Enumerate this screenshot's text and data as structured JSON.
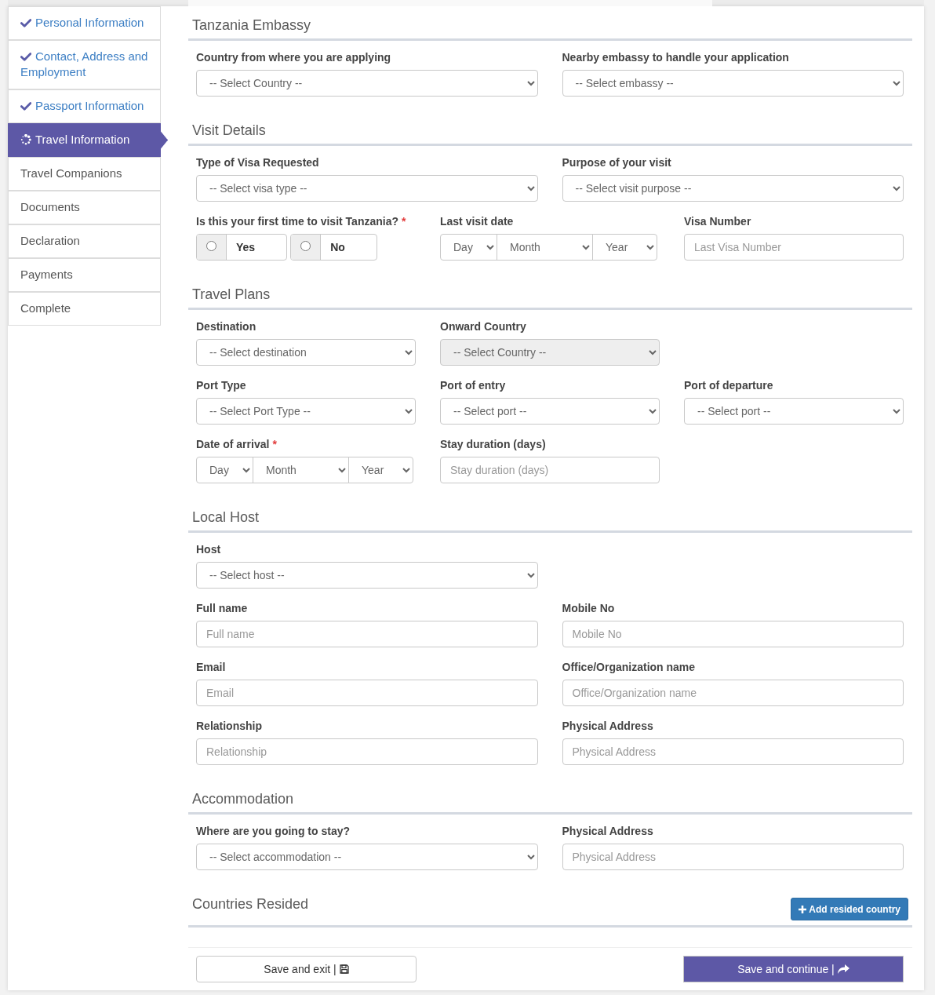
{
  "sidebar": {
    "items": [
      {
        "label": "Personal Information",
        "completed": true,
        "selected": false
      },
      {
        "label": "Contact, Address and Employment",
        "completed": true,
        "selected": false
      },
      {
        "label": "Passport Information",
        "completed": true,
        "selected": false
      },
      {
        "label": "Travel Information",
        "completed": false,
        "selected": true
      },
      {
        "label": "Travel Companions",
        "completed": false,
        "selected": false
      },
      {
        "label": "Documents",
        "completed": false,
        "selected": false
      },
      {
        "label": "Declaration",
        "completed": false,
        "selected": false
      },
      {
        "label": "Payments",
        "completed": false,
        "selected": false
      },
      {
        "label": "Complete",
        "completed": false,
        "selected": false
      }
    ]
  },
  "sections": [
    {
      "title": "Tanzania Embassy",
      "rows": [
        {
          "fields": [
            {
              "kind": "select",
              "label": "Country from where you are applying",
              "value": "-- Select Country --",
              "disabled": false
            },
            {
              "kind": "select",
              "label": "Nearby embassy to handle your application",
              "value": "-- Select embassy --",
              "disabled": false
            }
          ]
        }
      ]
    },
    {
      "title": "Visit Details",
      "rows": [
        {
          "fields": [
            {
              "kind": "select",
              "label": "Type of Visa Requested",
              "value": "-- Select visa type --",
              "disabled": false
            },
            {
              "kind": "select",
              "label": "Purpose of your visit",
              "value": "-- Select visit purpose --",
              "disabled": false
            }
          ]
        },
        {
          "fields": [
            {
              "kind": "radio",
              "label": "Is this your first time to visit Tanzania?",
              "required_mark": "*",
              "options": [
                {
                  "label": "Yes",
                  "checked": false
                },
                {
                  "label": "No",
                  "checked": false
                }
              ]
            },
            {
              "kind": "date",
              "label": "Last visit date",
              "parts": [
                "Day",
                "Month",
                "Year"
              ]
            },
            {
              "kind": "input",
              "label": "Visa Number",
              "placeholder": "Last Visa Number",
              "disabled": false
            }
          ]
        }
      ]
    },
    {
      "title": "Travel Plans",
      "rows": [
        {
          "fields": [
            {
              "kind": "select",
              "label": "Destination",
              "value": "-- Select destination",
              "disabled": false
            },
            {
              "kind": "select",
              "label": "Onward Country",
              "value": "-- Select Country --",
              "disabled": true
            }
          ]
        },
        {
          "fields": [
            {
              "kind": "select",
              "label": "Port Type",
              "value": "-- Select Port Type --",
              "disabled": false
            },
            {
              "kind": "select",
              "label": "Port of entry",
              "value": "-- Select port --",
              "disabled": false
            },
            {
              "kind": "select",
              "label": "Port of departure",
              "value": "-- Select port --",
              "disabled": false
            }
          ]
        },
        {
          "fields": [
            {
              "kind": "date",
              "label": "Date of arrival",
              "required_mark": "*",
              "parts": [
                "Day",
                "Month",
                "Year"
              ]
            },
            {
              "kind": "input",
              "label": "Stay duration (days)",
              "placeholder": "Stay duration (days)",
              "disabled": false
            }
          ]
        }
      ]
    },
    {
      "title": "Local Host",
      "rows": [
        {
          "fields": [
            {
              "kind": "select",
              "label": "Host",
              "value": "-- Select host --",
              "disabled": false
            }
          ]
        },
        {
          "fields": [
            {
              "kind": "input",
              "label": "Full name",
              "placeholder": "Full name",
              "disabled": false
            },
            {
              "kind": "input",
              "label": "Mobile No",
              "placeholder": "Mobile No",
              "disabled": false
            }
          ]
        },
        {
          "fields": [
            {
              "kind": "input",
              "label": "Email",
              "placeholder": "Email",
              "disabled": false
            },
            {
              "kind": "input",
              "label": "Office/Organization name",
              "placeholder": "Office/Organization name",
              "disabled": false
            }
          ]
        },
        {
          "fields": [
            {
              "kind": "input",
              "label": "Relationship",
              "placeholder": "Relationship",
              "disabled": false
            },
            {
              "kind": "input",
              "label": "Physical Address",
              "placeholder": "Physical Address",
              "disabled": false
            }
          ]
        }
      ]
    },
    {
      "title": "Accommodation",
      "rows": [
        {
          "fields": [
            {
              "kind": "select",
              "label": "Where are you going to stay?",
              "value": "-- Select accommodation --",
              "disabled": false
            },
            {
              "kind": "input",
              "label": "Physical Address",
              "placeholder": "Physical Address",
              "disabled": false
            }
          ]
        }
      ]
    },
    {
      "title": "Countries Resided",
      "button": {
        "label": "Add resided country"
      }
    }
  ],
  "footer": {
    "buttons": [
      {
        "kind": "secondary",
        "label": "Save and exit |"
      },
      {
        "kind": "primary",
        "label": "Save and continue |"
      }
    ]
  }
}
